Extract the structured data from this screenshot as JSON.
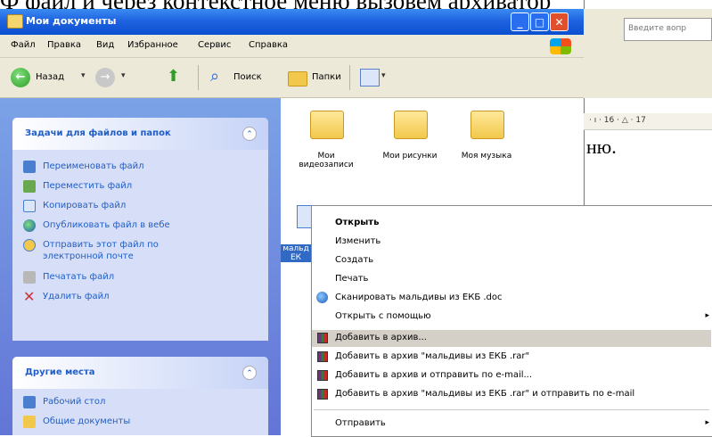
{
  "caption": {
    "text": "Ф файл и через контекстное меню вызовем архиватор"
  },
  "window": {
    "title": "Мои документы",
    "menu": [
      "Файл",
      "Правка",
      "Вид",
      "Избранное",
      "Сервис",
      "Справка"
    ],
    "toolbar": {
      "back": "Назад",
      "search": "Поиск",
      "folders": "Папки"
    }
  },
  "tasks_panel": {
    "title": "Задачи для файлов и папок",
    "items": [
      {
        "label": "Переименовать файл",
        "icon": "rename-icon"
      },
      {
        "label": "Переместить файл",
        "icon": "move-icon"
      },
      {
        "label": "Копировать файл",
        "icon": "copy-icon"
      },
      {
        "label": "Опубликовать файл в вебе",
        "icon": "web-icon"
      },
      {
        "label": "Отправить этот файл по",
        "label2": "электронной почте",
        "icon": "mail-icon"
      },
      {
        "label": "Печатать файл",
        "icon": "print-icon"
      },
      {
        "label": "Удалить файл",
        "icon": "delete-icon"
      }
    ]
  },
  "places_panel": {
    "title": "Другие места",
    "items": [
      {
        "label": "Рабочий стол",
        "icon": "desktop-icon"
      },
      {
        "label": "Общие документы",
        "icon": "shared-docs-icon"
      }
    ]
  },
  "folders": [
    {
      "line1": "Мои",
      "line2": "видеозаписи"
    },
    {
      "line1": "Мои рисунки",
      "line2": ""
    },
    {
      "line1": "Моя музыка",
      "line2": ""
    }
  ],
  "file": {
    "line1": "мальд",
    "line2": "ЕК"
  },
  "word": {
    "ask_placeholder": "Введите вопр",
    "ruler": "· ı · 16 · △ · 17",
    "text": "ню."
  },
  "context_menu": {
    "items": [
      {
        "label": "Открыть",
        "bold": true,
        "icon": ""
      },
      {
        "label": "Изменить",
        "icon": ""
      },
      {
        "label": "Создать",
        "icon": ""
      },
      {
        "label": "Печать",
        "icon": ""
      },
      {
        "label": "Сканировать мальдивы из ЕКБ .doc",
        "icon": "scan-icon"
      },
      {
        "label": "Открыть с помощью",
        "icon": "",
        "submenu": true
      },
      {
        "label": "Добавить в архив...",
        "icon": "rar-icon",
        "highlight": true
      },
      {
        "label": "Добавить в архив \"мальдивы из ЕКБ .rar\"",
        "icon": "rar-icon"
      },
      {
        "label": "Добавить в архив и отправить по e-mail...",
        "icon": "rar-icon"
      },
      {
        "label": "Добавить в архив \"мальдивы из ЕКБ .rar\" и отправить по e-mail",
        "icon": "rar-icon"
      },
      {
        "label": "Отправить",
        "icon": "",
        "submenu": true
      }
    ],
    "submenu_glyph": "▸"
  }
}
